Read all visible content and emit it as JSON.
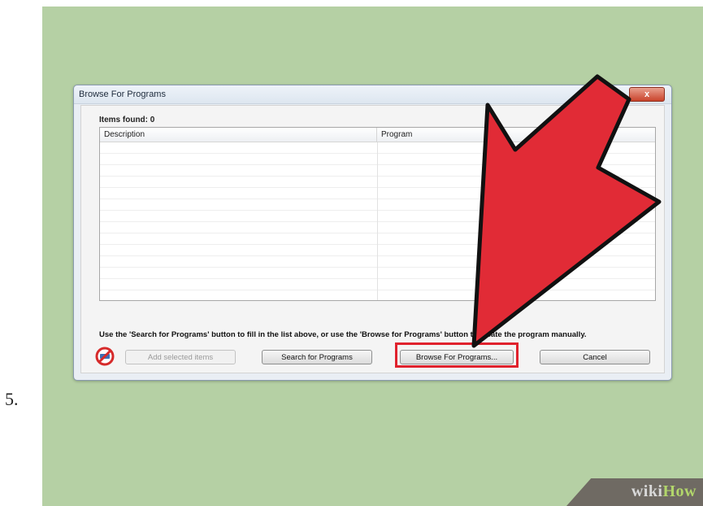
{
  "step": {
    "number": "5."
  },
  "dialog": {
    "title": "Browse For Programs",
    "close_label": "x",
    "items_found": "Items found: 0",
    "columns": [
      "Description",
      "Program"
    ],
    "hint": "Use the 'Search for Programs' button to fill in the list above, or use the 'Browse for Programs' button to locate the program manually.",
    "buttons": {
      "add": "Add selected items",
      "search": "Search for Programs",
      "browse": "Browse For Programs...",
      "cancel": "Cancel"
    }
  },
  "watermark": {
    "wiki": "wiki",
    "how": "How"
  },
  "colors": {
    "panel_background": "#b5d0a4",
    "arrow": "#e12b36",
    "highlight": "#e0222d",
    "watermark_green": "#b2d66b"
  },
  "icons": {
    "no_entry": "no-entry-icon"
  }
}
